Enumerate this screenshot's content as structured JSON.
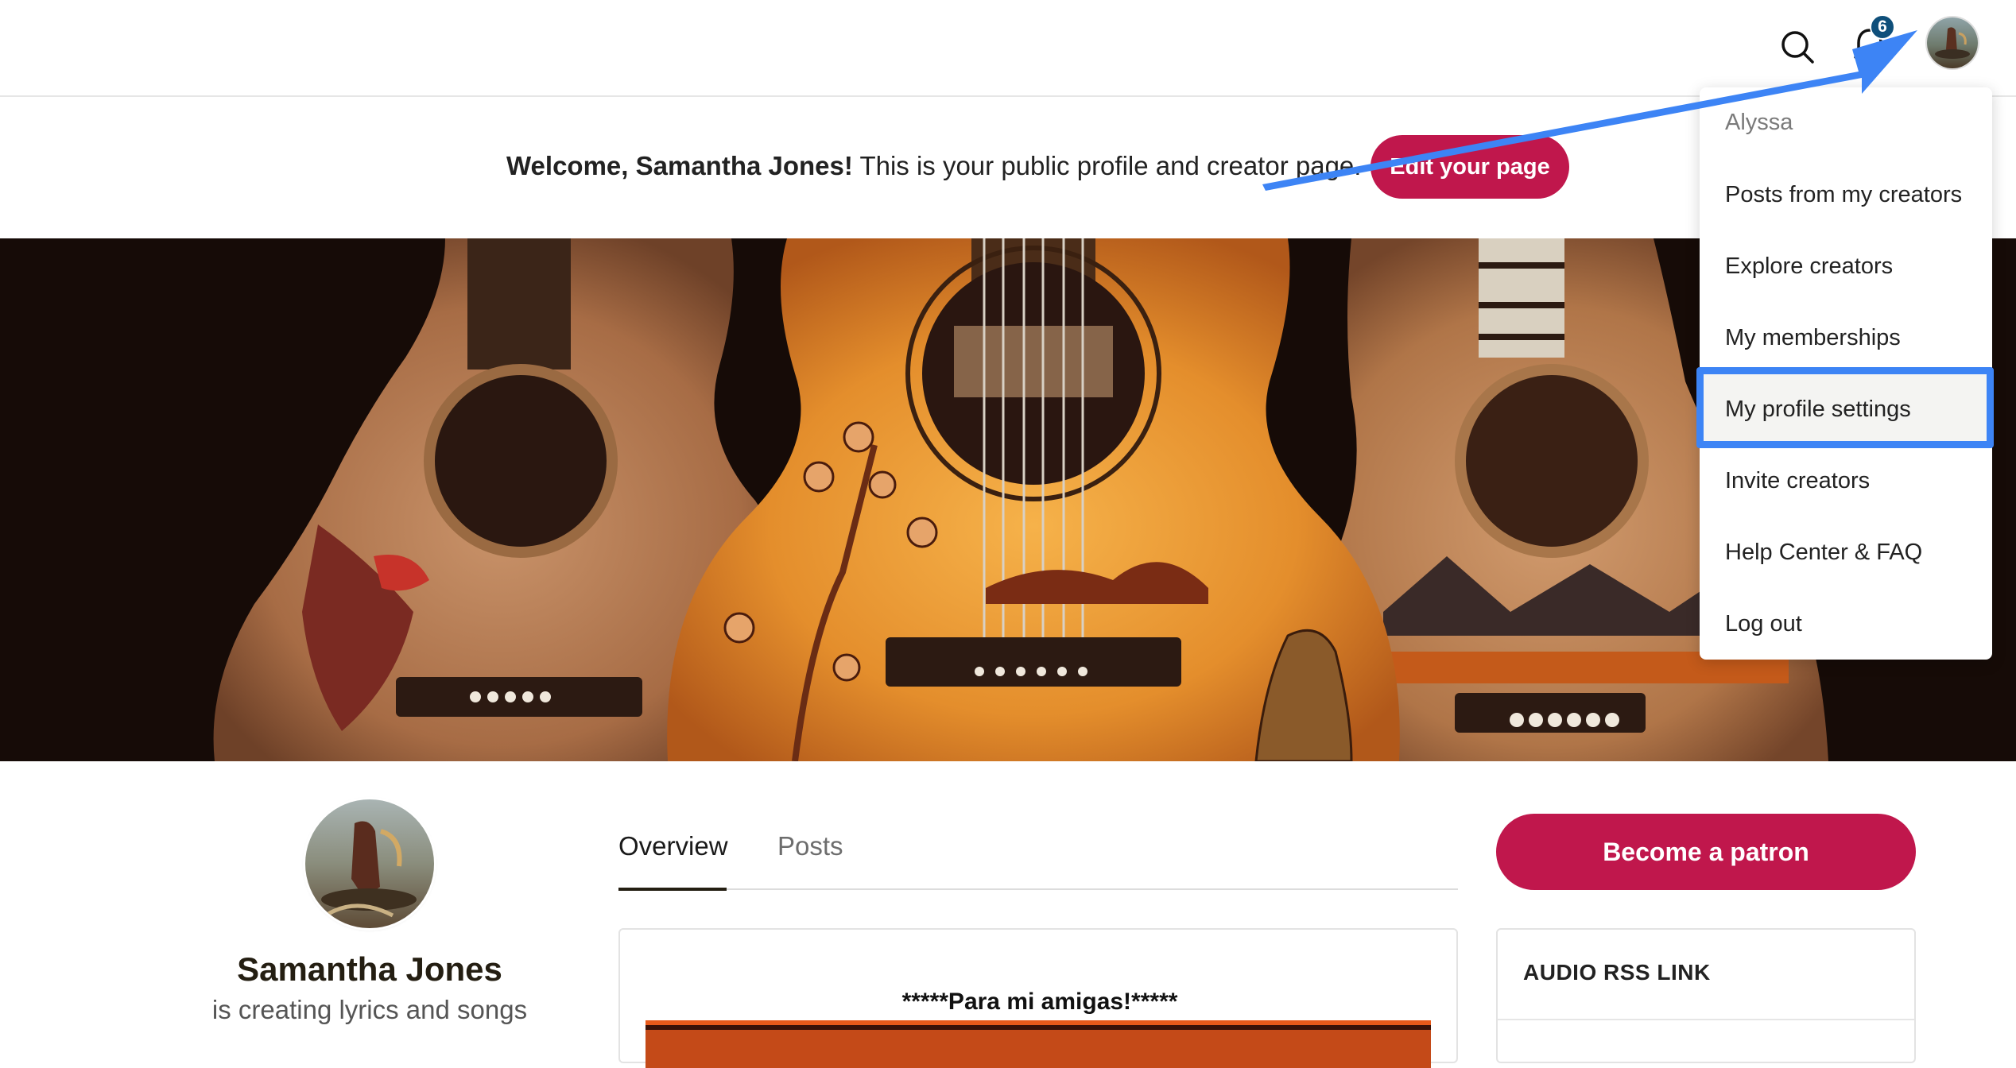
{
  "nav": {
    "notification_count": "6",
    "icons": [
      "search-icon",
      "bell-icon",
      "avatar"
    ]
  },
  "welcome": {
    "greeting": "Welcome, Samantha Jones!",
    "message": " This is your public profile and creator page.",
    "edit_button": "Edit your page"
  },
  "dropdown": {
    "user_name": "Alyssa",
    "items": [
      {
        "label": "Posts from my creators"
      },
      {
        "label": "Explore creators"
      },
      {
        "label": "My memberships"
      },
      {
        "label": "My profile settings"
      },
      {
        "label": "Invite creators"
      },
      {
        "label": "Help Center & FAQ"
      },
      {
        "label": "Log out"
      }
    ],
    "highlighted_item": "My profile settings"
  },
  "profile": {
    "name": "Samantha Jones",
    "tagline": "is creating lyrics and songs"
  },
  "tabs": [
    {
      "label": "Overview",
      "active": true
    },
    {
      "label": "Posts",
      "active": false
    }
  ],
  "post": {
    "title": "*****Para mi amigas!*****"
  },
  "sidebar": {
    "patron_button": "Become a patron",
    "rss_title": "AUDIO RSS LINK"
  },
  "colors": {
    "brand": "#c0174c",
    "annotation": "#3d84f5",
    "badge": "#0f4f7a"
  }
}
